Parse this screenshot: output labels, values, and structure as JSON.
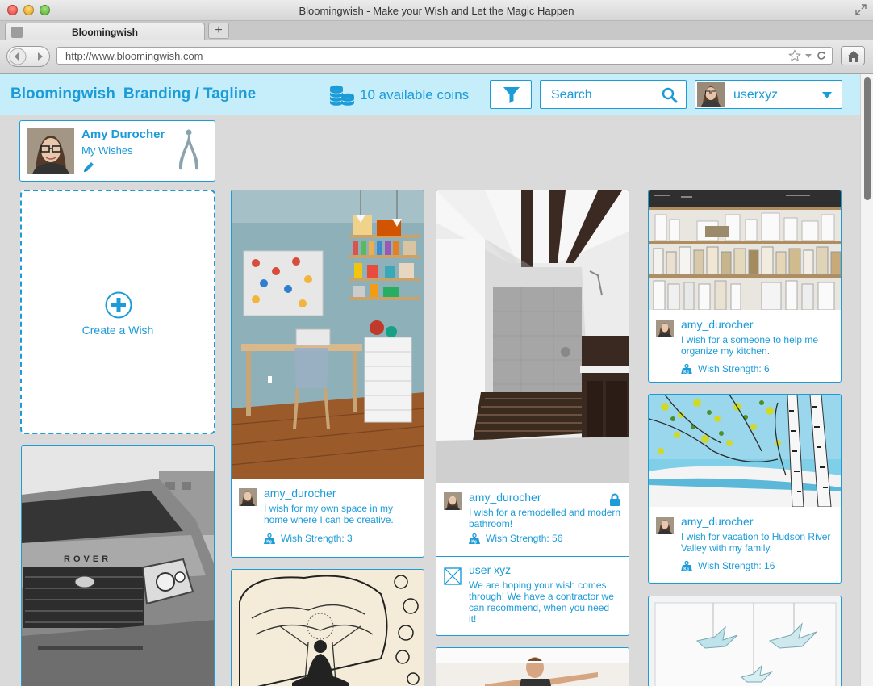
{
  "window": {
    "title": "Bloomingwish - Make your Wish and Let the Magic Happen",
    "tab_label": "Bloomingwish",
    "new_tab": "+",
    "url": "http://www.bloomingwish.com"
  },
  "header": {
    "brand": "Bloomingwish",
    "tagline": "Branding / Tagline",
    "coins_text": "10 available coins",
    "search_placeholder": "Search",
    "username": "userxyz"
  },
  "profile": {
    "name": "Amy Durocher",
    "link": "My Wishes"
  },
  "create": {
    "label": "Create a Wish"
  },
  "wishes": [
    {
      "user": "amy_durocher",
      "text": "I wish for my own space in my home where I can be creative.",
      "strength": "Wish Strength: 3"
    },
    {
      "user": "amy_durocher",
      "text": "I wish for a remodelled and modern bathroom!",
      "strength": "Wish Strength: 56",
      "comment_user": "user xyz",
      "comment_text": "We are hoping your wish comes through!  We have a contractor we can recommend, when you need it!"
    },
    {
      "user": "amy_durocher",
      "text": "I wish for a someone to help me organize my kitchen.",
      "strength": "Wish Strength: 6"
    },
    {
      "user": "amy_durocher",
      "text": "I wish for vacation to Hudson River Valley with my family.",
      "strength": "Wish Strength: 16"
    }
  ],
  "car_badge": "ROVER",
  "colors": {
    "accent": "#1b9bd8",
    "header_bg": "#c6eefa",
    "page_bg": "#dadada"
  },
  "icons": [
    "coins-icon",
    "filter-icon",
    "search-icon",
    "chevron-down-icon",
    "edit-icon",
    "wishbone-icon",
    "plus-icon",
    "kg-weight-icon",
    "lock-icon",
    "comment-avatar-icon",
    "home-icon",
    "star-icon",
    "reload-icon"
  ]
}
